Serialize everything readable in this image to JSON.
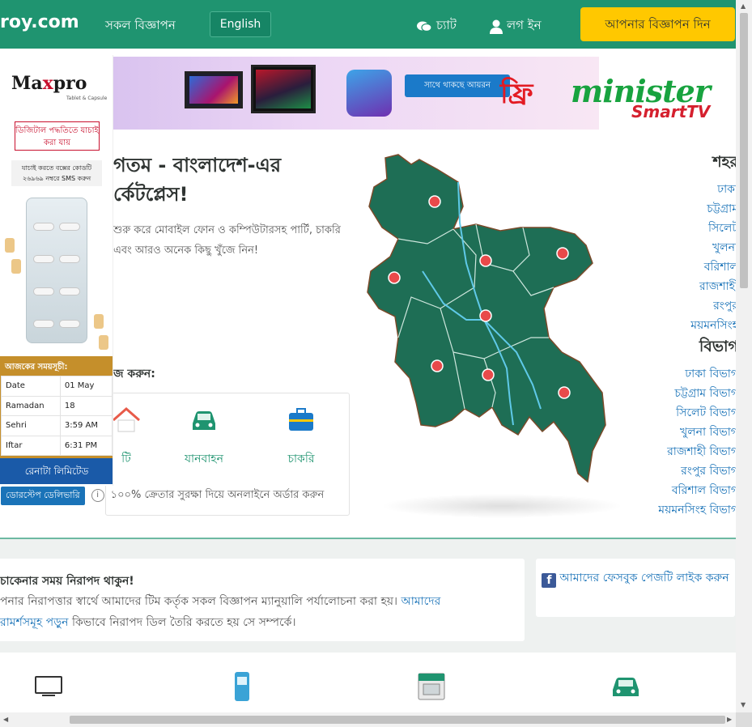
{
  "header": {
    "logo": "roy.com",
    "all_ads": "সকল বিজ্ঞাপন",
    "language": "English",
    "chat": "চ্যাট",
    "login": "লগ ইন",
    "post_ad": "আপনার বিজ্ঞাপন দিন"
  },
  "banner": {
    "promo_text": "সাথে থাকছে আয়রন",
    "promo_big": "ফ্রি",
    "brand": "minister",
    "brand_sub": "SmartTV"
  },
  "hero": {
    "welcome": "গতম - বাংলাদেশ-এর র্কেটপ্লেস!",
    "subtitle": "শুরু করে মোবাইল ফোন ও কম্পিউটারসহ পার্টি, চাকরি এবং আরও অনেক কিছু খুঁজে নিন!",
    "search_category": "জ করুন:",
    "categories": [
      {
        "label": "টি",
        "icon": "home-icon"
      },
      {
        "label": "যানবাহন",
        "icon": "car-icon"
      },
      {
        "label": "চাকরি",
        "icon": "briefcase-icon"
      }
    ],
    "trust_badge": "ডোরস্টেপ ডেলিভারি",
    "trust_text": "১০০% ক্রেতার সুরক্ষা দিয়ে অনলাইনে অর্ডার করুন"
  },
  "cities": {
    "heading": "শহর",
    "items": [
      "ঢাকা",
      "চট্টগ্রাম",
      "সিলেট",
      "খুলনা",
      "বরিশাল",
      "রাজশাহী",
      "রংপুর",
      "ময়মনসিংহ"
    ]
  },
  "divisions": {
    "heading": "বিভাগ",
    "items": [
      "ঢাকা বিভাগ",
      "চট্টগ্রাম বিভাগ",
      "সিলেট বিভাগ",
      "খুলনা বিভাগ",
      "রাজশাহী বিভাগ",
      "রংপুর বিভাগ",
      "বরিশাল বিভাগ",
      "ময়মনসিংহ বিভাগ"
    ]
  },
  "safety": {
    "title": "চাকেনার সময় নিরাপদ থাকুন!",
    "text": "পনার নিরাপত্তার স্বার্থে আমাদের টিম কর্তৃক সকল বিজ্ঞাপন ম্যানুয়ালি পর্যালোচনা করা হয়।",
    "link1": "আমাদের",
    "link2": "রামর্শসমূহ পড়ুন",
    "text2": "কিভাবে নিরাপদ ডিল তৈরি করতে হয় সে সম্পর্কে।"
  },
  "facebook": {
    "text": "আমাদের ফেসবুক পেজটি লাইক করুন"
  },
  "side_ad": {
    "brand_left": "Ma",
    "brand_x": "x",
    "brand_right": "pro",
    "brand_sub": "Tablet & Capsule",
    "verify": "ডিজিটাল পদ্ধতিতে যাচাই করা যায়",
    "sms": "যাচাই করতে বক্সের কোডটি ২৬৯৬৯ নম্বরে SMS করুন",
    "schedule_title": "আজকের সময়সূচী:",
    "schedule": [
      {
        "label": "Date",
        "value": "01 May"
      },
      {
        "label": "Ramadan",
        "value": "18"
      },
      {
        "label": "Sehri",
        "value": "3:59 AM"
      },
      {
        "label": "Iftar",
        "value": "6:31 PM"
      }
    ],
    "company": "রেনাটা লিমিটেড"
  },
  "colors": {
    "brand_green": "#1f9470",
    "accent_yellow": "#ffc800",
    "link_blue": "#1a73b8",
    "map_green": "#1e6e55"
  }
}
